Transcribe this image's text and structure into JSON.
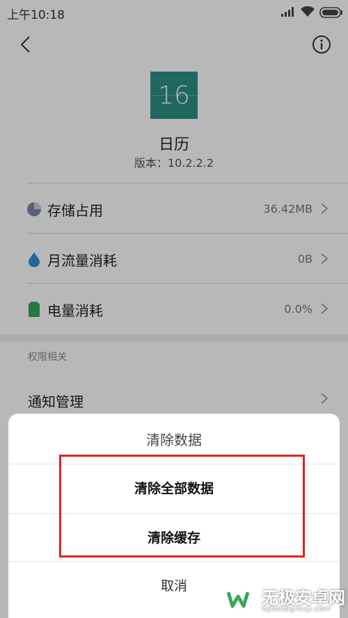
{
  "status_bar": {
    "time": "上午10:18"
  },
  "app": {
    "icon_number": "16",
    "name": "日历",
    "version": "版本：10.2.2.2"
  },
  "rows": [
    {
      "label": "存储占用",
      "value": "36.42MB"
    },
    {
      "label": "月流量消耗",
      "value": "0B"
    },
    {
      "label": "电量消耗",
      "value": "0.0%"
    }
  ],
  "permissions": {
    "section_title": "权限相关",
    "notify_label": "通知管理"
  },
  "dialog": {
    "title": "清除数据",
    "options": [
      "清除全部数据",
      "清除缓存"
    ],
    "cancel": "取消"
  },
  "watermark": {
    "title": "无极安卓网",
    "url": "wjhotelgroup.com"
  },
  "colors": {
    "accent": "#2b8f86",
    "highlight": "#e0221d",
    "storage_icon": "#7d88a8",
    "traffic_icon": "#2f8fd8",
    "battery_icon": "#3aa55b"
  }
}
